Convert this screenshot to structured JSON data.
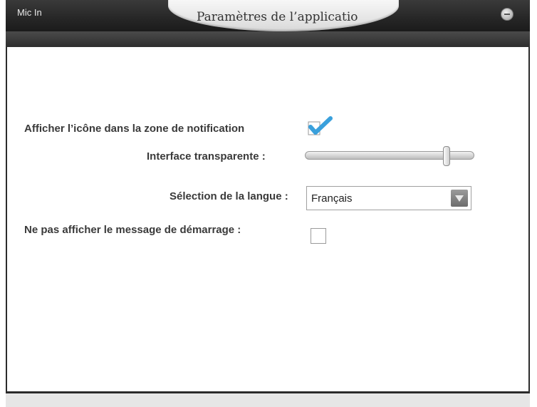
{
  "window": {
    "source_label": "Mic In",
    "title": "Paramètres de l’applicatio"
  },
  "settings": {
    "tray_icon": {
      "label": "Afficher l’icône dans la zone de notification",
      "checked": true
    },
    "transparency": {
      "label": "Interface transparente :",
      "level": 0.85
    },
    "language": {
      "label": "Sélection de la langue :",
      "selected": "Français"
    },
    "startup_message": {
      "label": "Ne pas afficher le message de démarrage :",
      "checked": false
    }
  },
  "colors": {
    "accent_check": "#3aa0dc",
    "titlebar": "#262626"
  },
  "icons": {
    "help": "help-icon",
    "check": "checkmark-icon",
    "dropdown": "chevron-down-icon"
  }
}
